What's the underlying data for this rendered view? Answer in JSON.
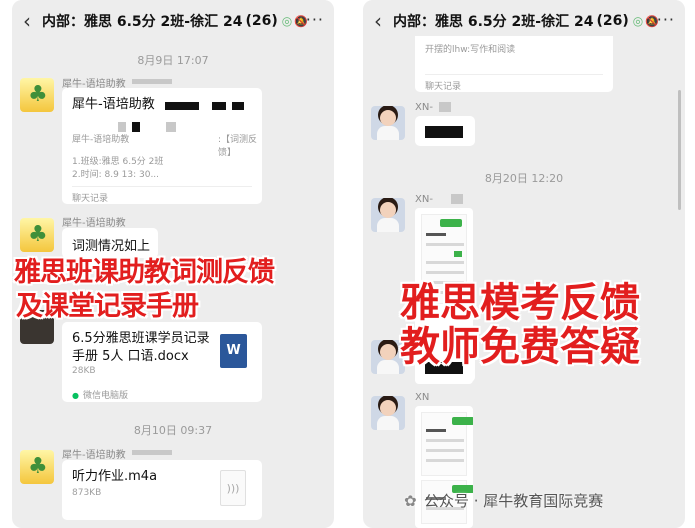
{
  "left": {
    "header": {
      "back": "‹",
      "title": "内部：雅思 6.5分 2班-徐汇 24",
      "count": "(26)",
      "more": "···"
    },
    "time1": "8月9日 17:07",
    "sender1": "犀牛-语培助教",
    "card": {
      "title": "犀牛-语培助教",
      "line1": "犀牛-语培助教",
      "tag": ":【词测反馈】",
      "line2": "1.班级:雅思 6.5分 2班",
      "line3": "2.时间: 8.9  13:  30...",
      "foot": "聊天记录"
    },
    "sender2": "犀牛-语培助教",
    "msg2": "词测情况如上",
    "file": {
      "name": "6.5分雅思班课学员记录手册 5人 口语.docx",
      "size": "28KB",
      "word_icon": "W",
      "source": "微信电脑版"
    },
    "time2": "8月10日 09:37",
    "sender3": "犀牛-语培助教",
    "audio": {
      "name": "听力作业.m4a",
      "size": "873KB"
    }
  },
  "right": {
    "header": {
      "back": "‹",
      "title": "内部：雅思 6.5分 2班-徐汇 24",
      "count": "(26)",
      "more": "···"
    },
    "top_card": {
      "line": "开摆的lhw:写作和阅读",
      "foot": "聊天记录"
    },
    "sender1": "XN-",
    "time1": "8月20日 12:20",
    "sender2": "XN-",
    "sender3": "XN"
  },
  "overlays": {
    "left_line1": "雅思班课助教词测反馈",
    "left_line2": "及课堂记录手册",
    "right_line1": "雅思模考反馈",
    "right_line2": "教师免费答疑"
  },
  "watermark": "公众号 · 犀牛教育国际竞赛",
  "colors": {
    "overlay_red": "#e21e1e",
    "chat_bg": "#ededed",
    "badge_green": "#3cb24a",
    "word_blue": "#2b579a"
  }
}
